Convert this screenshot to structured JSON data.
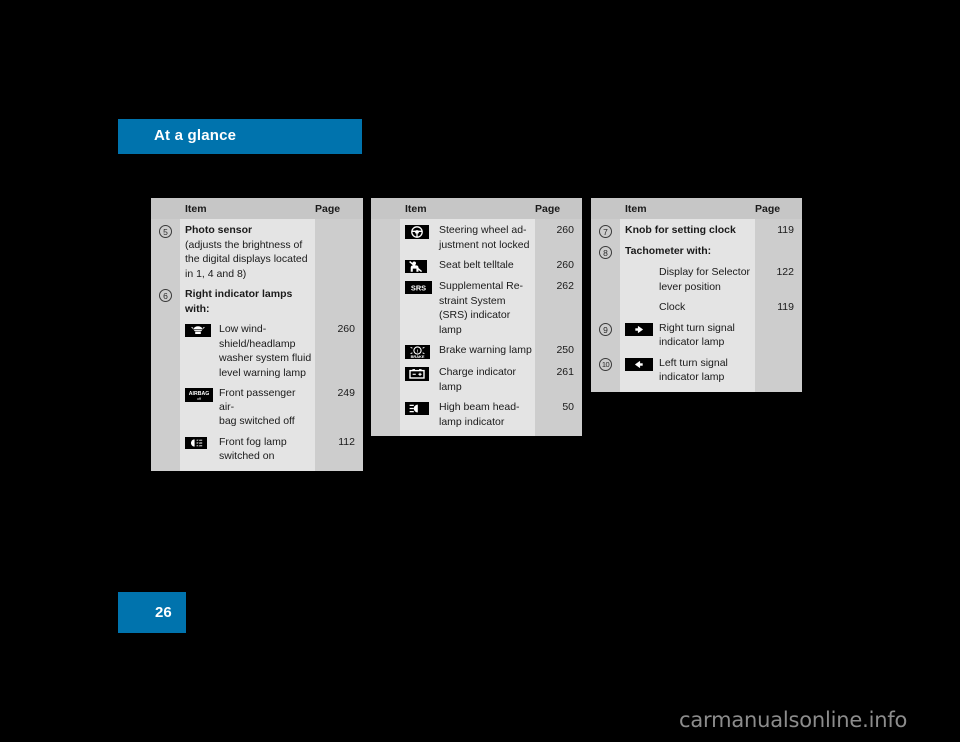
{
  "header": {
    "title": "At a glance",
    "accent_color": "#0073ad"
  },
  "page_badge": {
    "number": "26"
  },
  "watermark": {
    "text": "carmanualsonline.info"
  },
  "tables": [
    {
      "id": "table-left",
      "columns": {
        "item": "Item",
        "page": "Page"
      },
      "rows": [
        {
          "index": "5",
          "icon": null,
          "lines": [
            {
              "text": "Photo sensor",
              "bold": true
            },
            {
              "text": "(adjusts the brightness of",
              "bold": false
            },
            {
              "text": "the digital displays located",
              "bold": false
            },
            {
              "text": "in 1, 4 and 8)",
              "bold": false
            }
          ],
          "page": ""
        },
        {
          "index": "6",
          "icon": null,
          "lines": [
            {
              "text": "Right indicator lamps",
              "bold": true
            },
            {
              "text": "with:",
              "bold": true
            }
          ],
          "page": ""
        },
        {
          "index": "",
          "icon": "windshield-washer-fluid-icon",
          "lines": [
            {
              "text": "Low wind-",
              "bold": false
            },
            {
              "text": "shield/headlamp",
              "bold": false
            },
            {
              "text": "washer system fluid",
              "bold": false
            },
            {
              "text": "level warning lamp",
              "bold": false
            }
          ],
          "page": "260"
        },
        {
          "index": "",
          "icon": "airbag-off-icon",
          "lines": [
            {
              "text": "Front passenger air-",
              "bold": false
            },
            {
              "text": "bag switched off",
              "bold": false
            }
          ],
          "page": "249"
        },
        {
          "index": "",
          "icon": "front-fog-lamp-icon",
          "lines": [
            {
              "text": "Front fog lamp",
              "bold": false
            },
            {
              "text": "switched on",
              "bold": false
            }
          ],
          "page": "112"
        }
      ]
    },
    {
      "id": "table-middle",
      "columns": {
        "item": "Item",
        "page": "Page"
      },
      "rows": [
        {
          "index": "",
          "icon": "steering-wheel-icon",
          "lines": [
            {
              "text": "Steering wheel ad-",
              "bold": false
            },
            {
              "text": "justment not locked",
              "bold": false
            }
          ],
          "page": "260"
        },
        {
          "index": "",
          "icon": "seat-belt-icon",
          "lines": [
            {
              "text": "Seat belt telltale",
              "bold": false
            }
          ],
          "page": "260"
        },
        {
          "index": "",
          "icon": "srs-icon",
          "lines": [
            {
              "text": "Supplemental Re-",
              "bold": false
            },
            {
              "text": "straint System",
              "bold": false
            },
            {
              "text": "(SRS) indicator",
              "bold": false
            },
            {
              "text": "lamp",
              "bold": false
            }
          ],
          "page": "262"
        },
        {
          "index": "",
          "icon": "brake-warning-icon",
          "lines": [
            {
              "text": "Brake warning lamp",
              "bold": false
            }
          ],
          "page": "250"
        },
        {
          "index": "",
          "icon": "charge-indicator-icon",
          "lines": [
            {
              "text": "Charge indicator",
              "bold": false
            },
            {
              "text": "lamp",
              "bold": false
            }
          ],
          "page": "261"
        },
        {
          "index": "",
          "icon": "high-beam-icon",
          "lines": [
            {
              "text": "High beam head-",
              "bold": false
            },
            {
              "text": "lamp indicator",
              "bold": false
            }
          ],
          "page": "50"
        }
      ]
    },
    {
      "id": "table-right",
      "columns": {
        "item": "Item",
        "page": "Page"
      },
      "rows": [
        {
          "index": "7",
          "icon": null,
          "lines": [
            {
              "text": "Knob for setting clock",
              "bold": true
            }
          ],
          "page": "119"
        },
        {
          "index": "8",
          "icon": null,
          "lines": [
            {
              "text": "Tachometer with:",
              "bold": true
            }
          ],
          "page": ""
        },
        {
          "index": "",
          "icon": null,
          "indent": true,
          "lines": [
            {
              "text": "Display for Selector",
              "bold": false
            },
            {
              "text": "lever position",
              "bold": false
            }
          ],
          "page": "122"
        },
        {
          "index": "",
          "icon": null,
          "indent": true,
          "lines": [
            {
              "text": "Clock",
              "bold": false
            }
          ],
          "page": "119"
        },
        {
          "index": "9",
          "icon": "right-turn-signal-icon",
          "lines": [
            {
              "text": "Right turn signal",
              "bold": false
            },
            {
              "text": "indicator lamp",
              "bold": false
            }
          ],
          "page": ""
        },
        {
          "index": "10",
          "icon": "left-turn-signal-icon",
          "lines": [
            {
              "text": "Left turn signal",
              "bold": false
            },
            {
              "text": "indicator lamp",
              "bold": false
            }
          ],
          "page": ""
        }
      ]
    }
  ]
}
